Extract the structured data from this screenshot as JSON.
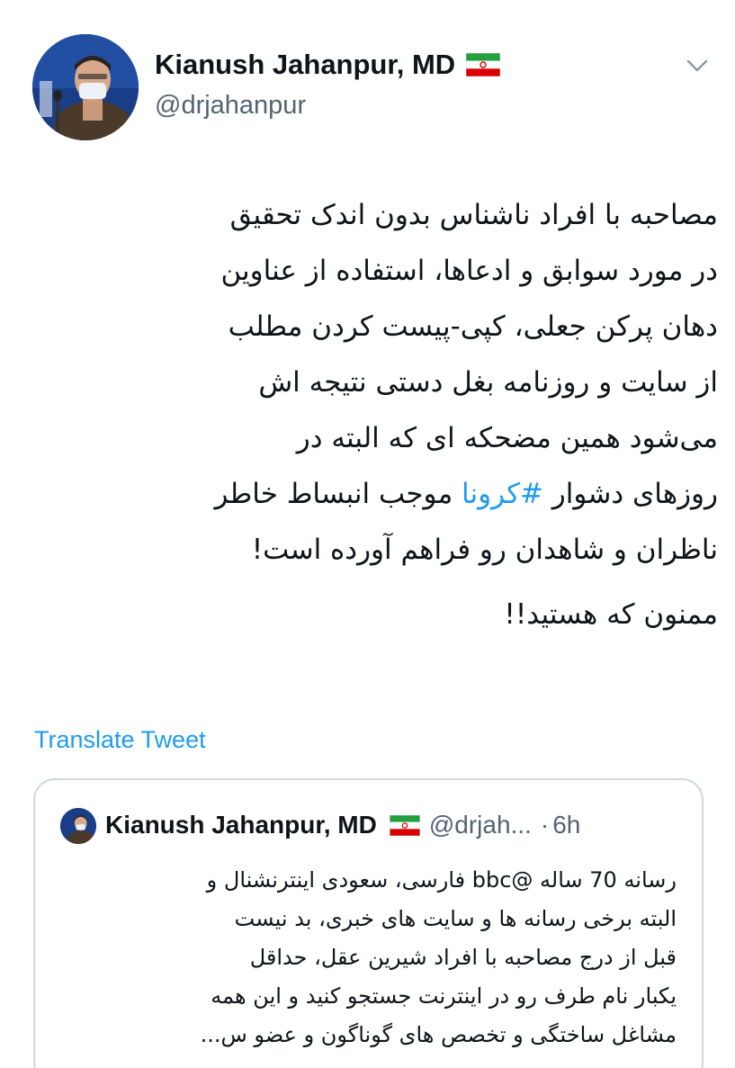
{
  "author": {
    "display_name": "Kianush Jahanpur, MD",
    "handle": "@drjahanpur"
  },
  "tweet": {
    "lines": [
      "مصاحبه با افراد ناشناس بدون اندک تحقیق",
      "در مورد سوابق و ادعاها، استفاده از عناوین",
      "دهان پرکن جعلی،  کپی-پیست کردن مطلب",
      "از سایت و روزنامه بغل دستی نتیجه اش",
      "می‌شود همین مضحکه ای که البته در"
    ],
    "line_hashtag": {
      "before": "روزهای دشوار ",
      "hashtag": "#کرونا",
      "after": " موجب انبساط خاطر"
    },
    "line_last": "ناظران و شاهدان رو فراهم آورده است!",
    "thanks": "ممنون که هستید!!"
  },
  "translate_label": "Translate Tweet",
  "quoted_tweet": {
    "display_name": "Kianush Jahanpur, MD",
    "handle": "@drjah...",
    "separator": "·",
    "time": "6h",
    "lines": [
      "رسانه 70 ساله @bbc فارسی، سعودی اینترنشنال و",
      "البته برخی رسانه ها و سایت های خبری، بد نیست",
      "قبل از درج مصاحبه با افراد شیرین عقل، حداقل",
      "یکبار نام طرف رو در اینترنت جستجو کنید و این همه",
      "مشاغل ساختگی و تخصص های گوناگون و عضو س..."
    ]
  },
  "colors": {
    "text": "#0f1419",
    "secondary": "#536471",
    "link": "#1d9bf0",
    "border": "#cfd9de",
    "flag_green": "#239f40",
    "flag_red": "#da0000"
  },
  "icons": {
    "flag": "iran-flag-icon",
    "menu": "chevron-down-icon"
  }
}
